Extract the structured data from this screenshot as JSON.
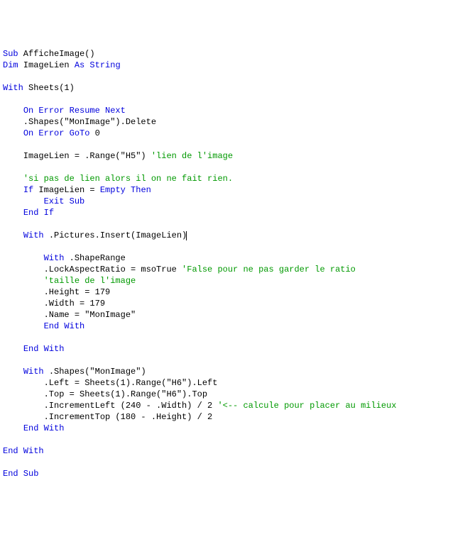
{
  "code": {
    "lines": [
      {
        "segments": [
          {
            "cls": "kw",
            "t": "Sub"
          },
          {
            "cls": "tx",
            "t": " AfficheImage()"
          }
        ]
      },
      {
        "segments": [
          {
            "cls": "kw",
            "t": "Dim"
          },
          {
            "cls": "tx",
            "t": " ImageLien "
          },
          {
            "cls": "kw",
            "t": "As String"
          }
        ]
      },
      {
        "segments": []
      },
      {
        "segments": [
          {
            "cls": "kw",
            "t": "With"
          },
          {
            "cls": "tx",
            "t": " Sheets(1)"
          }
        ]
      },
      {
        "segments": []
      },
      {
        "segments": [
          {
            "cls": "tx",
            "t": "    "
          },
          {
            "cls": "kw",
            "t": "On Error Resume Next"
          }
        ]
      },
      {
        "segments": [
          {
            "cls": "tx",
            "t": "    .Shapes(\"MonImage\").Delete"
          }
        ]
      },
      {
        "segments": [
          {
            "cls": "tx",
            "t": "    "
          },
          {
            "cls": "kw",
            "t": "On Error GoTo"
          },
          {
            "cls": "tx",
            "t": " 0"
          }
        ]
      },
      {
        "segments": []
      },
      {
        "segments": [
          {
            "cls": "tx",
            "t": "    ImageLien = .Range(\"H5\") "
          },
          {
            "cls": "cm",
            "t": "'lien de l'image"
          }
        ]
      },
      {
        "segments": []
      },
      {
        "segments": [
          {
            "cls": "tx",
            "t": "    "
          },
          {
            "cls": "cm",
            "t": "'si pas de lien alors il on ne fait rien."
          }
        ]
      },
      {
        "segments": [
          {
            "cls": "tx",
            "t": "    "
          },
          {
            "cls": "kw",
            "t": "If"
          },
          {
            "cls": "tx",
            "t": " ImageLien = "
          },
          {
            "cls": "kw",
            "t": "Empty Then"
          }
        ]
      },
      {
        "segments": [
          {
            "cls": "tx",
            "t": "        "
          },
          {
            "cls": "kw",
            "t": "Exit Sub"
          }
        ]
      },
      {
        "segments": [
          {
            "cls": "tx",
            "t": "    "
          },
          {
            "cls": "kw",
            "t": "End If"
          }
        ]
      },
      {
        "segments": []
      },
      {
        "segments": [
          {
            "cls": "tx",
            "t": "    "
          },
          {
            "cls": "kw",
            "t": "With"
          },
          {
            "cls": "tx",
            "t": " .Pictures.Insert(ImageLien)"
          },
          {
            "cls": "cursor",
            "t": ""
          }
        ]
      },
      {
        "segments": []
      },
      {
        "segments": [
          {
            "cls": "tx",
            "t": "        "
          },
          {
            "cls": "kw",
            "t": "With"
          },
          {
            "cls": "tx",
            "t": " .ShapeRange"
          }
        ]
      },
      {
        "segments": [
          {
            "cls": "tx",
            "t": "        .LockAspectRatio = msoTrue "
          },
          {
            "cls": "cm",
            "t": "'False pour ne pas garder le ratio"
          }
        ]
      },
      {
        "segments": [
          {
            "cls": "tx",
            "t": "        "
          },
          {
            "cls": "cm",
            "t": "'taille de l'image"
          }
        ]
      },
      {
        "segments": [
          {
            "cls": "tx",
            "t": "        .Height = 179"
          }
        ]
      },
      {
        "segments": [
          {
            "cls": "tx",
            "t": "        .Width = 179"
          }
        ]
      },
      {
        "segments": [
          {
            "cls": "tx",
            "t": "        .Name = \"MonImage\""
          }
        ]
      },
      {
        "segments": [
          {
            "cls": "tx",
            "t": "        "
          },
          {
            "cls": "kw",
            "t": "End With"
          }
        ]
      },
      {
        "segments": []
      },
      {
        "segments": [
          {
            "cls": "tx",
            "t": "    "
          },
          {
            "cls": "kw",
            "t": "End With"
          }
        ]
      },
      {
        "segments": []
      },
      {
        "segments": [
          {
            "cls": "tx",
            "t": "    "
          },
          {
            "cls": "kw",
            "t": "With"
          },
          {
            "cls": "tx",
            "t": " .Shapes(\"MonImage\")"
          }
        ]
      },
      {
        "segments": [
          {
            "cls": "tx",
            "t": "        .Left = Sheets(1).Range(\"H6\").Left"
          }
        ]
      },
      {
        "segments": [
          {
            "cls": "tx",
            "t": "        .Top = Sheets(1).Range(\"H6\").Top"
          }
        ]
      },
      {
        "segments": [
          {
            "cls": "tx",
            "t": "        .IncrementLeft (240 - .Width) / 2 "
          },
          {
            "cls": "cm",
            "t": "'<-- calcule pour placer au milieux"
          }
        ]
      },
      {
        "segments": [
          {
            "cls": "tx",
            "t": "        .IncrementTop (180 - .Height) / 2"
          }
        ]
      },
      {
        "segments": [
          {
            "cls": "tx",
            "t": "    "
          },
          {
            "cls": "kw",
            "t": "End With"
          }
        ]
      },
      {
        "segments": []
      },
      {
        "segments": [
          {
            "cls": "kw",
            "t": "End With"
          }
        ]
      },
      {
        "segments": []
      },
      {
        "segments": [
          {
            "cls": "kw",
            "t": "End Sub"
          }
        ]
      }
    ]
  }
}
